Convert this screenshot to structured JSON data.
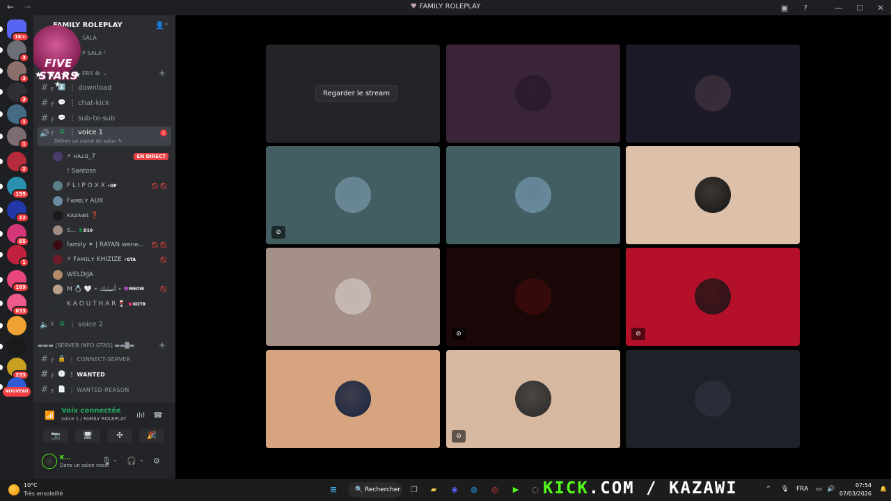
{
  "window": {
    "title": "FAMILY ROLEPLAY",
    "back_icon": "←",
    "forward_icon": "→",
    "controls": [
      "—",
      "☐",
      "✕"
    ]
  },
  "server_rail": {
    "items": [
      {
        "badge": "1K+",
        "color": "#5865f2"
      },
      {
        "badge": "3",
        "color": "#6b6e75"
      },
      {
        "badge": "3",
        "color": "#8a6f6a"
      },
      {
        "badge": "3",
        "color": "#2f2f35"
      },
      {
        "badge": "1",
        "color": "#456b86"
      },
      {
        "badge": "1",
        "color": "#7d6c70"
      },
      {
        "badge": "2",
        "color": "#b72c3c"
      },
      {
        "badge": "195",
        "color": "#2b8fb0"
      },
      {
        "badge": "12",
        "color": "#2238a8"
      },
      {
        "badge": "65",
        "color": "#d4367a"
      },
      {
        "badge": "1",
        "color": "#c2213d"
      },
      {
        "badge": "169",
        "color": "#e8457a"
      },
      {
        "badge": "633",
        "color": "#ee5a8a"
      },
      {
        "badge": "",
        "color": "#f0a232"
      },
      {
        "badge": "",
        "color": "#1a1a1a"
      },
      {
        "badge": "233",
        "color": "#c9a020"
      },
      {
        "badge": "",
        "color": "#2f5bd6"
      }
    ],
    "new_tag": "NOUVEAU"
  },
  "sidebar": {
    "server_name": "FAMILY ROLEPLAY",
    "banner_text": "FIVE STARS",
    "banner_stars": "★ ★ ★ ★ ★",
    "partial_rows": [
      "SALA",
      "P SALA ²",
      "ERS ♻"
    ],
    "channels": [
      {
        "emoji": "⬇️",
        "name": "download"
      },
      {
        "emoji": "💬",
        "name": "chat-kick"
      },
      {
        "emoji": "💬",
        "name": "sub-to-sub"
      }
    ],
    "voice1": {
      "emoji": "♻",
      "name": "voice 1",
      "badge": "1",
      "status": "Définir un statut de salon ✎"
    },
    "voice_users": [
      {
        "name": "⚡ ʜᴀᴊᴊɪ_7",
        "tag": "",
        "live": "EN DIRECT",
        "mute": "",
        "color": "#4a3b6e"
      },
      {
        "name": "! Santoss",
        "tag": "",
        "live": "",
        "mute": "",
        "color": "#2b2d31"
      },
      {
        "name": "F L I P O X X",
        "tag": "⚡OP",
        "live": "",
        "mute": "🚫 🚫",
        "color": "#5d7d8a"
      },
      {
        "name": "Fᴀᴍɪʟʏ AUX",
        "tag": "",
        "live": "",
        "mute": "",
        "color": "#6a8aa0"
      },
      {
        "name": "ĸᴀᴢᴀᴡɪ ❓",
        "tag": "",
        "live": "",
        "mute": "",
        "color": "#1a1a1a"
      },
      {
        "name": "s...",
        "tag": "💲D10",
        "live": "",
        "mute": "",
        "color": "#a08c82"
      },
      {
        "name": "family ✦ | RAYAN wene...",
        "tag": "",
        "live": "",
        "mute": "🚫 🚫",
        "color": "#3a0d12"
      },
      {
        "name": "⚡ Fᴀᴍɪʟʏ KHIZIZE",
        "tag": "⚡GTA",
        "live": "",
        "mute": "🚫",
        "color": "#6d1d2a"
      },
      {
        "name": "WELDIJA",
        "tag": "",
        "live": "",
        "mute": "",
        "color": "#b38a6a"
      },
      {
        "name": "M 💍 🤍 ⋆ أميتيك ⋆",
        "tag": "💜MEOW",
        "live": "",
        "mute": "🚫",
        "color": "#b8a08a"
      },
      {
        "name": "K A O U T H A R 🍷",
        "tag": "💗KOTR",
        "live": "",
        "mute": "",
        "color": "#2a2d36"
      }
    ],
    "voice2": {
      "emoji": "♻",
      "name": "voice 2"
    },
    "category2": "▬▬▬ [SERVER INFO GTA5] ▬▬█▬",
    "info_channels": [
      {
        "emoji": "🔒",
        "name": "CONNECT-SERVER",
        "bright": false
      },
      {
        "emoji": "🕘",
        "name": "WANTED",
        "bright": true
      },
      {
        "emoji": "📄",
        "name": "WANTED-REASON",
        "bright": false
      }
    ],
    "voice_panel": {
      "title": "Voix connectée",
      "subtitle": "voice 1 / FAMILY ROLEPLAY",
      "buttons": [
        "📷",
        "🖥",
        "✣",
        "🎉"
      ]
    },
    "user_panel": {
      "name": "K...",
      "status": "Dans un salon vocal"
    }
  },
  "stage": {
    "watch_label": "Regarder le stream",
    "tiles": [
      {
        "bg": "#232428",
        "avatar": "",
        "mute": false,
        "watch": true
      },
      {
        "bg": "#3a2438",
        "avatar": "#2a1a2e",
        "mute": false,
        "watch": false
      },
      {
        "bg": "#1c1a28",
        "avatar": "#3a2e3a",
        "mute": false,
        "watch": false
      },
      {
        "bg": "#425e62",
        "avatar": "#6d8a9a",
        "mute": true,
        "watch": false
      },
      {
        "bg": "#425e62",
        "avatar": "#6b8ba0",
        "mute": false,
        "watch": false
      },
      {
        "bg": "#dcc0aa",
        "avatar": "#151515",
        "mute": false,
        "watch": false
      },
      {
        "bg": "#a59088",
        "avatar": "#c8bcb8",
        "mute": false,
        "watch": false
      },
      {
        "bg": "#1a0808",
        "avatar": "#3a0a0a",
        "mute": true,
        "watch": false
      },
      {
        "bg": "#b5102a",
        "avatar": "#2a1518",
        "mute": true,
        "watch": false
      },
      {
        "bg": "#d6a47e",
        "avatar": "#1a2540",
        "mute": false,
        "watch": false
      },
      {
        "bg": "#d7b9a2",
        "avatar": "#2a2a2a",
        "mute": true,
        "watch": false
      },
      {
        "bg": "#1d2128",
        "avatar": "#2a2f3a",
        "mute": false,
        "watch": false
      }
    ]
  },
  "taskbar": {
    "temp": "10°C",
    "condition": "Très ensoleillé",
    "search": "Rechercher",
    "overlay_green": "KICK",
    "overlay_white": ".COM / KAZAWI",
    "lang": "FRA",
    "time": "07:54",
    "date": "07/03/2026"
  }
}
